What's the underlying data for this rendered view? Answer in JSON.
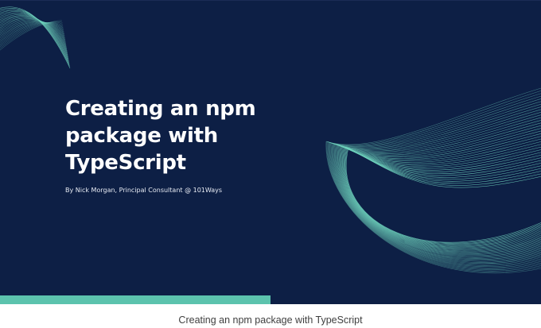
{
  "hero": {
    "title": "Creating an npm package with TypeScript",
    "byline": "By Nick Morgan, Principal Consultant @ 101Ways"
  },
  "caption": "Creating an npm package with TypeScript",
  "colors": {
    "background": "#0d1f45",
    "accent": "#5cc3ad",
    "wave": "#6fd3bd",
    "text": "#ffffff"
  },
  "icons": [
    "wave-pattern-top-left",
    "wave-pattern-right"
  ]
}
